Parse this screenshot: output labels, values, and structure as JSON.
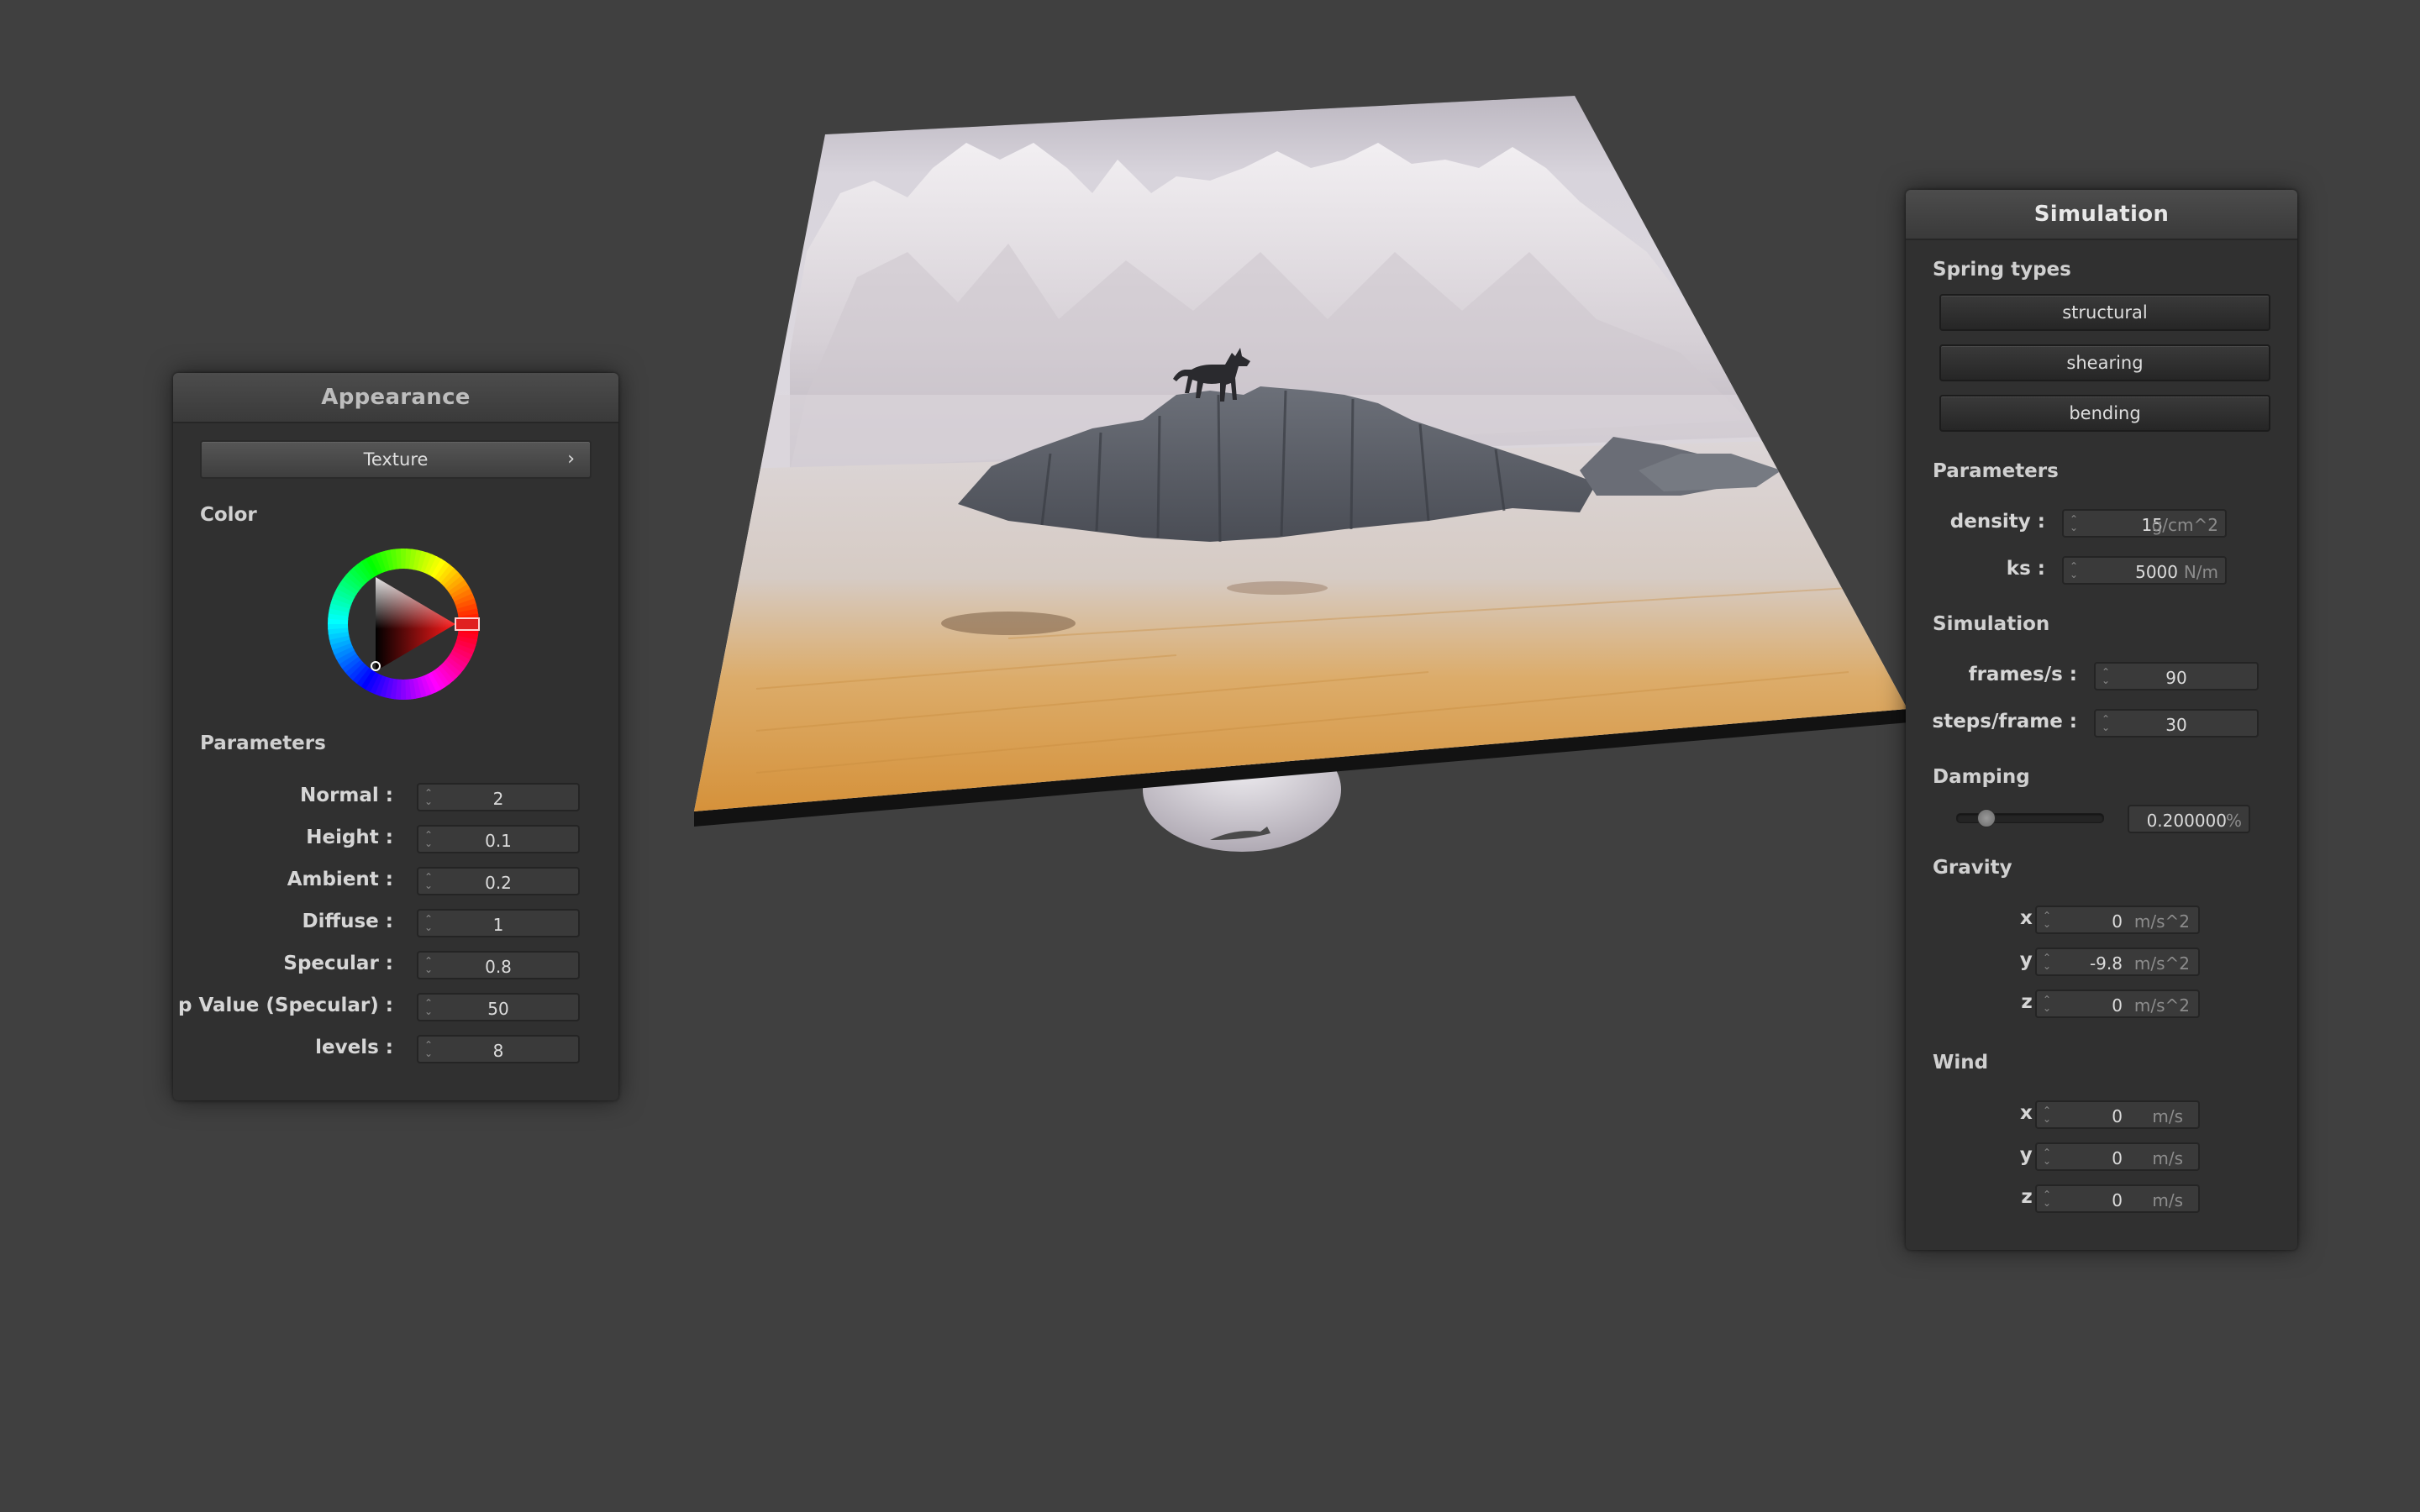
{
  "appearance": {
    "title": "Appearance",
    "texture_button": "Texture",
    "texture_chevron": "›",
    "color_section": "Color",
    "params_section": "Parameters",
    "params": [
      {
        "label": "Normal :",
        "value": "2"
      },
      {
        "label": "Height :",
        "value": "0.1"
      },
      {
        "label": "Ambient :",
        "value": "0.2"
      },
      {
        "label": "Diffuse :",
        "value": "1"
      },
      {
        "label": "Specular :",
        "value": "0.8"
      },
      {
        "label": "p Value (Specular) :",
        "value": "50"
      },
      {
        "label": "levels :",
        "value": "8"
      }
    ],
    "selected_color": "#d62020"
  },
  "simulation": {
    "title": "Simulation",
    "spring_section": "Spring types",
    "springs": [
      "structural",
      "shearing",
      "bending"
    ],
    "params_section": "Parameters",
    "density": {
      "label": "density :",
      "value": "15",
      "unit": "g/cm^2"
    },
    "ks": {
      "label": "ks :",
      "value": "5000",
      "unit": "N/m"
    },
    "sim_section": "Simulation",
    "frames": {
      "label": "frames/s :",
      "value": "90"
    },
    "steps": {
      "label": "steps/frame :",
      "value": "30"
    },
    "damping_section": "Damping",
    "damping": {
      "value": "0.200000",
      "unit": "%",
      "slider_fraction": 0.2
    },
    "gravity_section": "Gravity",
    "gravity": [
      {
        "label": "x :",
        "value": "0",
        "unit": "m/s^2"
      },
      {
        "label": "y :",
        "value": "-9.8",
        "unit": "m/s^2"
      },
      {
        "label": "z :",
        "value": "0",
        "unit": "m/s^2"
      }
    ],
    "wind_section": "Wind",
    "wind": [
      {
        "label": "x :",
        "value": "0",
        "unit": "m/s"
      },
      {
        "label": "y :",
        "value": "0",
        "unit": "m/s"
      },
      {
        "label": "z :",
        "value": "0",
        "unit": "m/s"
      }
    ]
  },
  "spin_glyphs": {
    "up": "⌃",
    "down": "⌄"
  },
  "colors": {
    "background": "#404040",
    "panel": "#303030",
    "sky": "#c8c4cc",
    "grass": "#d89a48",
    "rock": "#5a5e66"
  }
}
